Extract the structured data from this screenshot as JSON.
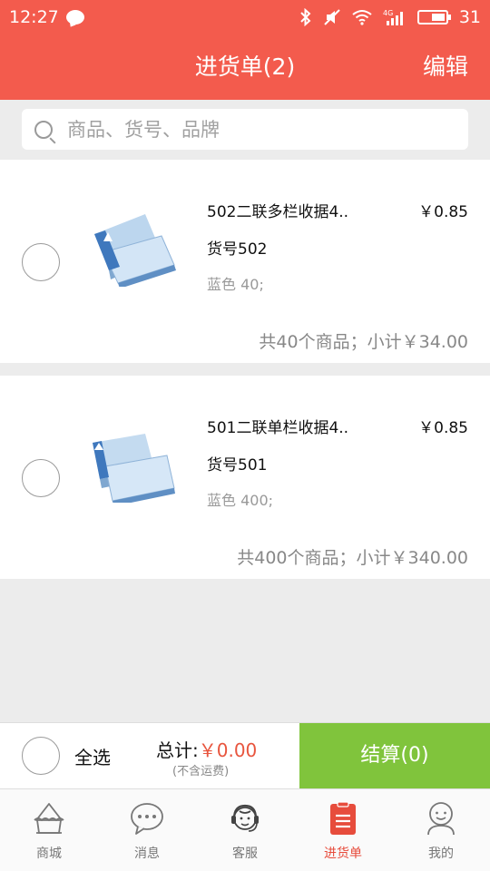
{
  "status_bar": {
    "time": "12:27",
    "signal_tag": "4G",
    "battery": "31"
  },
  "navbar": {
    "title": "进货单(2)",
    "edit_label": "编辑"
  },
  "search": {
    "placeholder": "商品、货号、品牌",
    "value": ""
  },
  "cart_items": [
    {
      "name": "502二联多栏收据4..",
      "price": "￥0.85",
      "code": "货号502",
      "spec": "蓝色 40;",
      "summary": "共40个商品；小计￥34.00"
    },
    {
      "name": "501二联单栏收据4..",
      "price": "￥0.85",
      "code": "货号501",
      "spec": "蓝色 400;",
      "summary": "共400个商品；小计￥340.00"
    }
  ],
  "footer": {
    "select_all": "全选",
    "total_label": "总计:",
    "total_value": "￥0.00",
    "shipping_note": "(不含运费)",
    "checkout_label": "结算(0)"
  },
  "tabs": [
    {
      "label": "商城",
      "icon": "shop-icon"
    },
    {
      "label": "消息",
      "icon": "message-icon"
    },
    {
      "label": "客服",
      "icon": "customer-service-icon"
    },
    {
      "label": "进货单",
      "icon": "order-list-icon",
      "active": true
    },
    {
      "label": "我的",
      "icon": "profile-icon"
    }
  ],
  "colors": {
    "brand": "#f35b4d",
    "checkout": "#80c43c",
    "price_accent": "#e8553e"
  }
}
